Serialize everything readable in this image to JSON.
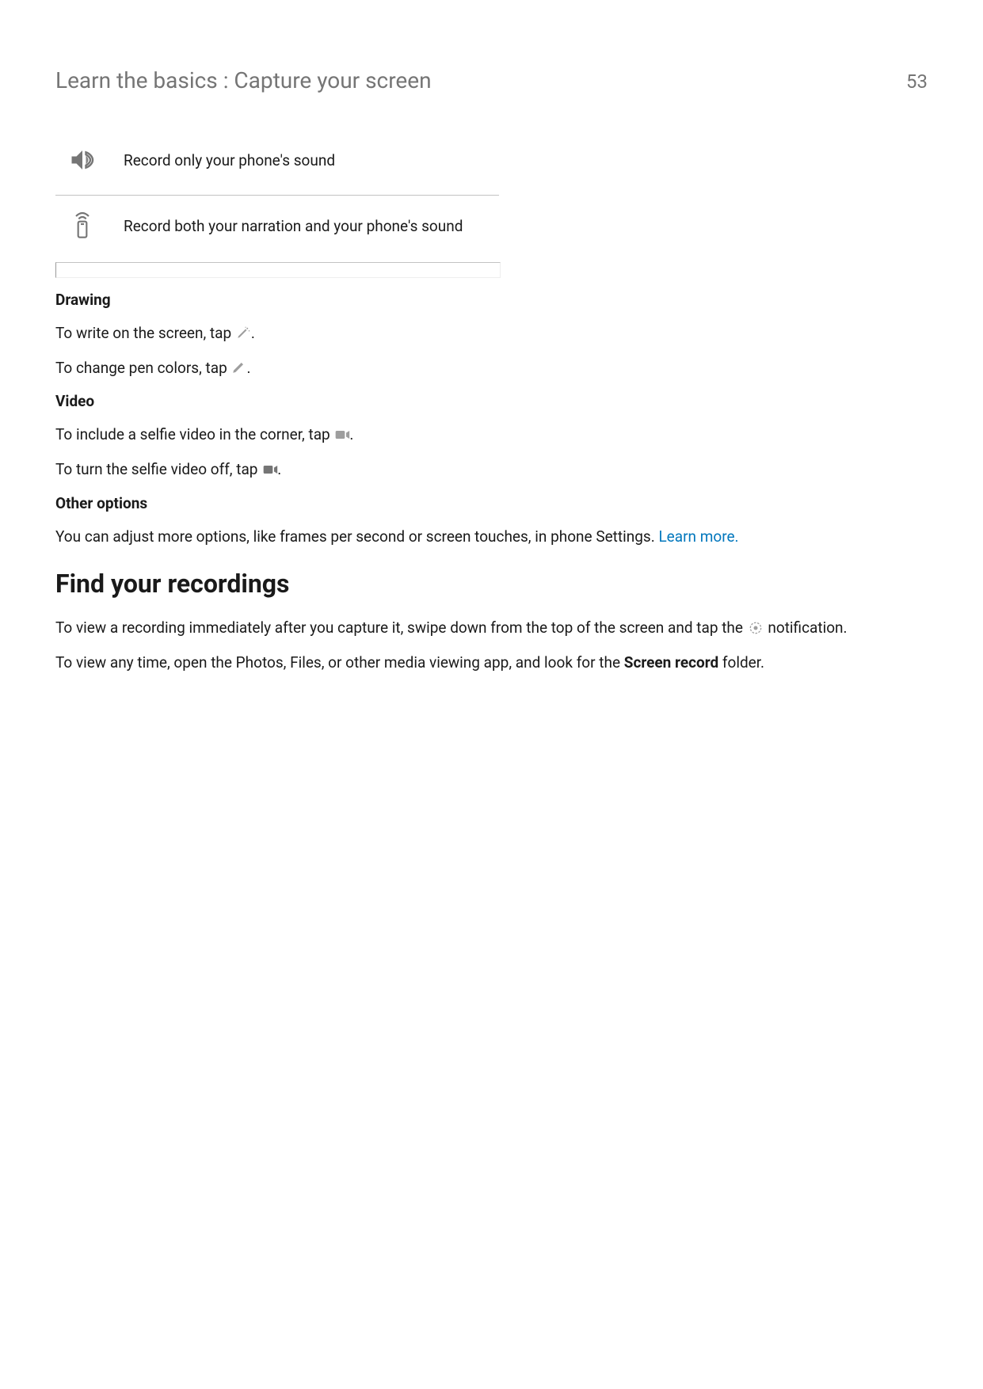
{
  "header": {
    "title": "Learn the basics : Capture your screen",
    "page_number": "53"
  },
  "options": [
    {
      "text": "Record only your phone's sound"
    },
    {
      "text": "Record both your narration and your phone's sound"
    }
  ],
  "drawing": {
    "heading": "Drawing",
    "line1_a": "To write on the screen, tap ",
    "line1_b": ".",
    "line2_a": "To change pen colors, tap ",
    "line2_b": "."
  },
  "video": {
    "heading": "Video",
    "line1_a": "To include a selfie video in the corner, tap ",
    "line1_b": ".",
    "line2_a": "To turn the selfie video off, tap ",
    "line2_b": "."
  },
  "other": {
    "heading": "Other options",
    "text": "You can adjust more options, like frames per second or screen touches, in phone Settings. ",
    "link": "Learn more."
  },
  "recordings": {
    "heading": "Find your recordings",
    "p1_a": "To view a recording immediately after you capture it, swipe down from the top of the screen and tap the ",
    "p1_b": " notification.",
    "p2_a": "To view any time, open the Photos, Files, or other media viewing app, and look for the ",
    "p2_bold": "Screen record",
    "p2_b": " folder."
  }
}
